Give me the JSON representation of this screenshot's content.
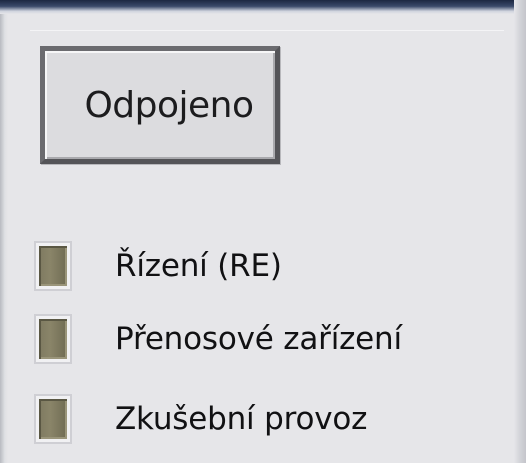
{
  "status_button": {
    "label": "Odpojeno"
  },
  "indicators": [
    {
      "label": "Řízení (RE)"
    },
    {
      "label": "Přenosové zařízení"
    },
    {
      "label": "Zkušební provoz"
    }
  ],
  "colors": {
    "panel_background": "#e6e6e9",
    "led_off": "#837e63",
    "text": "#111113"
  }
}
